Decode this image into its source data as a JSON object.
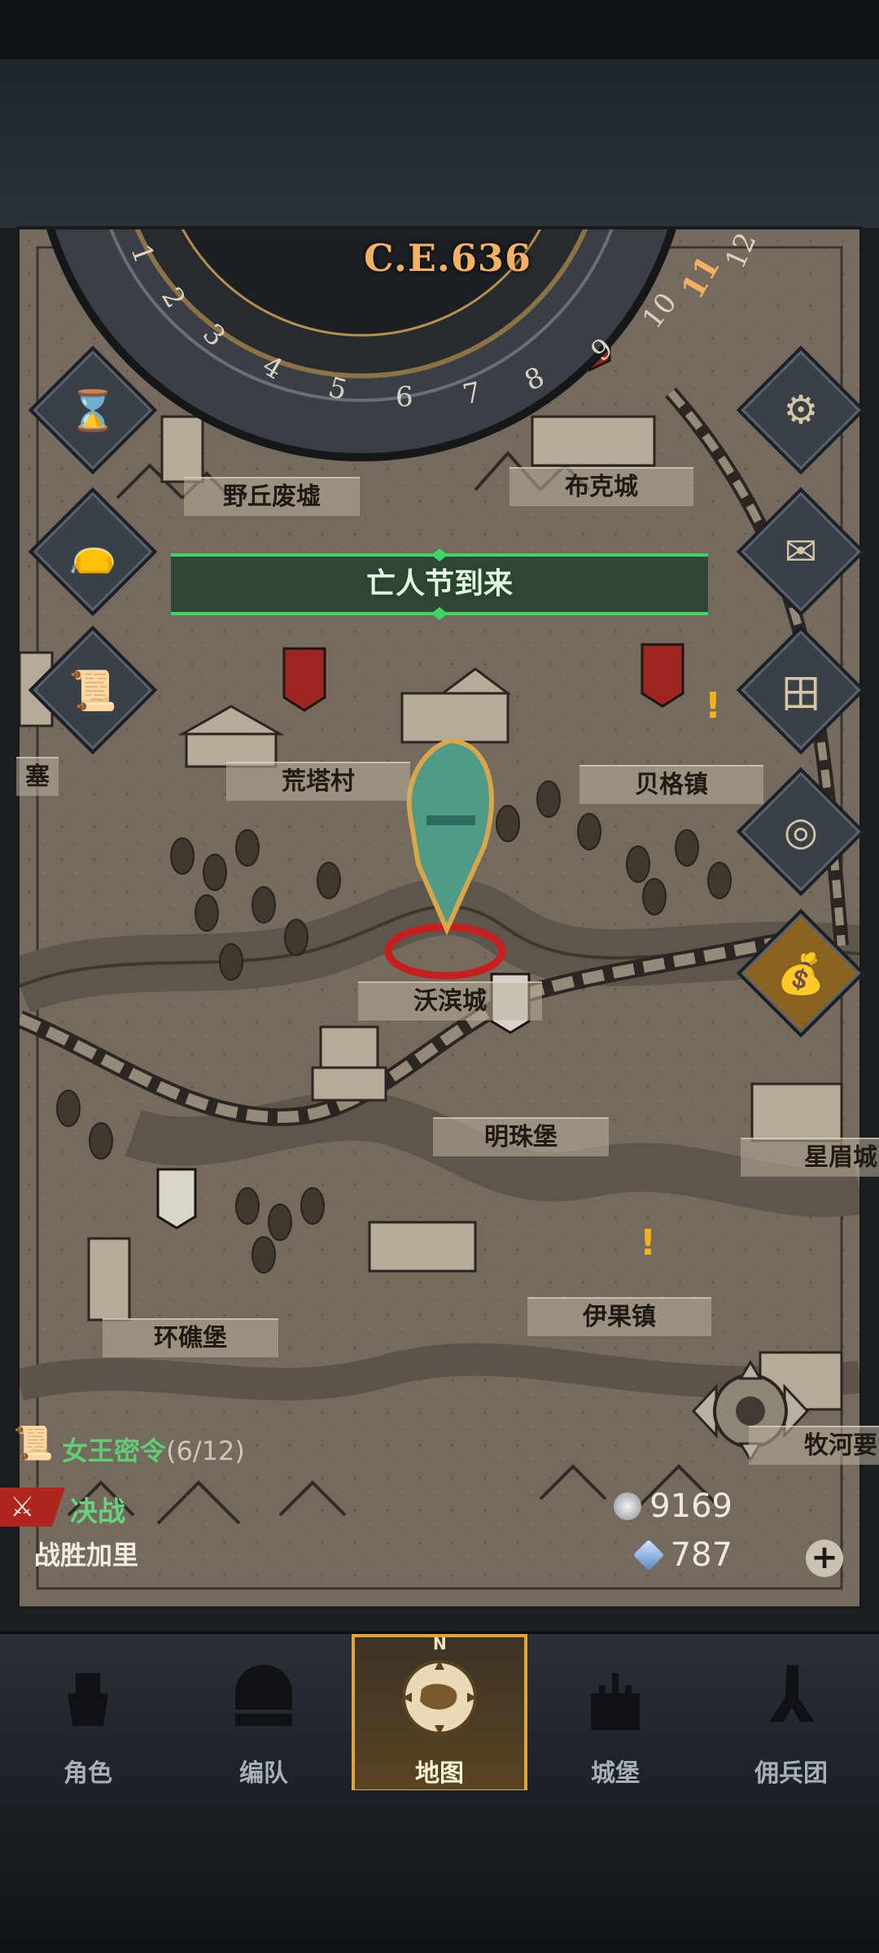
{
  "era": "C.E.636",
  "calendar": {
    "months": [
      "1",
      "2",
      "3",
      "4",
      "5",
      "6",
      "7",
      "8",
      "9",
      "10",
      "11",
      "12"
    ],
    "current_month": "11"
  },
  "event_banner": "亡人节到来",
  "towns": {
    "yeqiu": "野丘废墟",
    "buke": "布克城",
    "huangta": "荒塔村",
    "beige": "贝格镇",
    "wobin": "沃滨城",
    "mingzhu": "明珠堡",
    "huanjiao": "环礁堡",
    "yiguo": "伊果镇",
    "xingmei": "星眉城",
    "muhe": "牧河要",
    "sai": "塞"
  },
  "side_buttons_left": [
    "hourglass-icon",
    "bag-icon",
    "scroll-icon"
  ],
  "side_buttons_right": [
    "gear-icon",
    "mail-icon",
    "grid-icon",
    "coin-icon",
    "money-bag-icon"
  ],
  "quest": {
    "title": "女王密令",
    "progress": "(6/12)"
  },
  "battle": {
    "tag": "决战",
    "desc": "战胜加里"
  },
  "resources": {
    "silver": "9169",
    "crystal": "787"
  },
  "compass_letter": "N",
  "nav": [
    {
      "label": "角色",
      "icon": "knight-icon",
      "active": false
    },
    {
      "label": "编队",
      "icon": "formation-icon",
      "active": false
    },
    {
      "label": "地图",
      "icon": "map-compass-icon",
      "active": true
    },
    {
      "label": "城堡",
      "icon": "castle-icon",
      "active": false
    },
    {
      "label": "佣兵团",
      "icon": "mercenary-icon",
      "active": false
    }
  ],
  "colors": {
    "accent_orange": "#f4b063",
    "quest_green": "#5fcf74",
    "event_green": "#3fd46a",
    "active_tab_border": "#e2a43c",
    "banner_red": "#a2261f"
  }
}
